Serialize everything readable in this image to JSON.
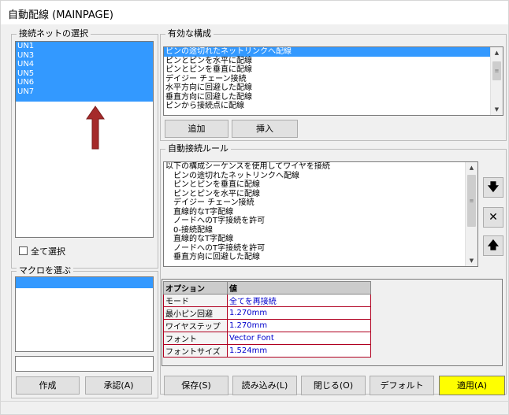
{
  "window": {
    "title": "自動配線 (MAINPAGE)"
  },
  "nets": {
    "legend": "接続ネットの選択",
    "items": [
      "UN1",
      "UN3",
      "UN4",
      "UN5",
      "UN6",
      "UN7"
    ],
    "select_all_label": "全て選択"
  },
  "macros": {
    "legend": "マクロを選ぶ",
    "create_label": "作成",
    "approve_label": "承認(A)"
  },
  "valid_config": {
    "legend": "有効な構成",
    "items": [
      "ピンの途切れたネットリンクへ配線",
      "ピンとピンを水平に配線",
      "ピンとピンを垂直に配線",
      "デイジー チェーン接続",
      "水平方向に回避した配線",
      "垂直方向に回避した配線",
      "ピンから接続点に配線"
    ],
    "add_label": "追加",
    "insert_label": "挿入"
  },
  "rules": {
    "legend": "自動接続ルール",
    "items": [
      "以下の構成シーケンスを使用してワイヤを接続",
      "ピンの途切れたネットリンクへ配線",
      "ピンとピンを垂直に配線",
      "ピンとピンを水平に配線",
      "デイジー チェーン接続",
      "直線的なT字配線",
      "ノードへのT字接続を許可",
      "0-接続配線",
      "直線的なT字配線",
      "ノードへのT字接続を許可",
      "垂直方向に回避した配線"
    ]
  },
  "options": {
    "header_option": "オプション",
    "header_value": "値",
    "rows": [
      {
        "key": "モード",
        "value": "全てを再接続"
      },
      {
        "key": "最小ピン回避",
        "value": "1.270mm"
      },
      {
        "key": "ワイヤステップ",
        "value": "1.270mm"
      },
      {
        "key": "フォント",
        "value": "Vector Font"
      },
      {
        "key": "フォントサイズ",
        "value": "1.524mm"
      }
    ]
  },
  "footer": {
    "save_label": "保存(S)",
    "load_label": "読み込み(L)",
    "close_label": "閉じる(O)",
    "default_label": "デフォルト",
    "apply_label": "適用(A)"
  },
  "icons": {
    "annotation_arrow": "up-arrow-icon",
    "move_down": "down-arrow-icon",
    "delete": "x-icon",
    "move_up": "up-arrow-icon"
  },
  "colors": {
    "selection": "#3399ff",
    "apply_button": "#ffff00",
    "annotation_arrow": "#a52a2a"
  }
}
